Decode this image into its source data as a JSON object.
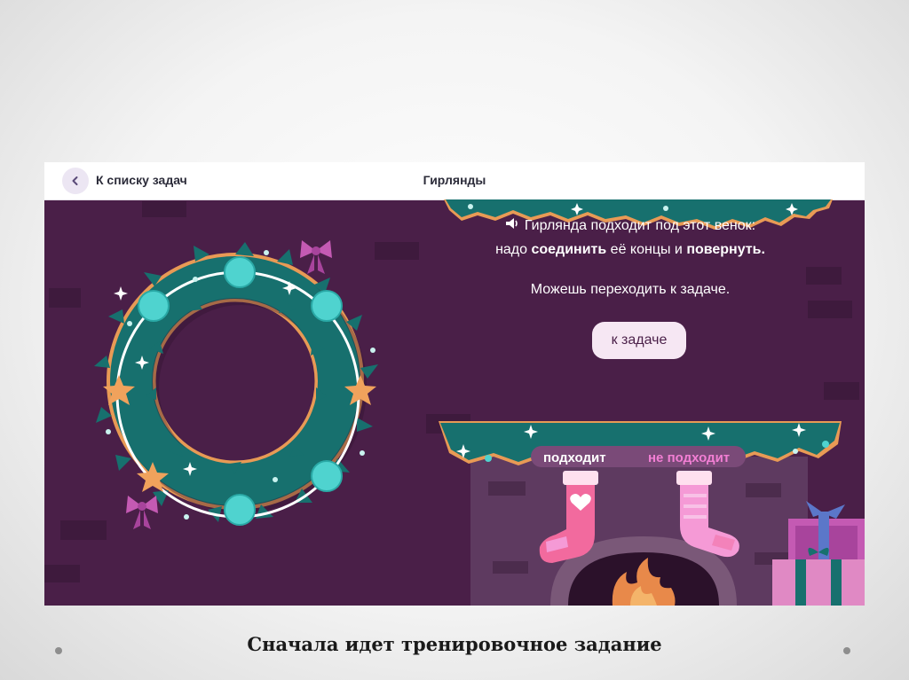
{
  "header": {
    "back_label": "К списку задач",
    "title": "Гирлянды"
  },
  "message": {
    "line1": "Гирлянда подходит под этот венок:",
    "line2_prefix": "надо ",
    "line2_bold1": "соединить",
    "line2_middle": " её концы и ",
    "line2_bold2": "повернуть",
    "line2_suffix": ".",
    "line3": "Можешь переходить к задаче."
  },
  "task_button": {
    "label": "к задаче"
  },
  "stockings": {
    "fits_label": "подходит",
    "not_fits_label": "не подходит"
  },
  "caption": "Сначала идет тренировочное задание",
  "colors": {
    "background": "#4a1f48",
    "wreath": "#17706e",
    "bead": "#4fd3cf",
    "star": "#f0a25c",
    "bow": "#c45ab3",
    "stocking_fits": "#f26a9e",
    "stocking_nofit": "#f59ad6",
    "button_bg": "#f6e7f3"
  },
  "icons": [
    "back-chevron-icon",
    "speaker-icon",
    "heart-icon",
    "bow-icon",
    "star-icon",
    "sparkle-icon",
    "fire-icon",
    "gift-icon"
  ]
}
